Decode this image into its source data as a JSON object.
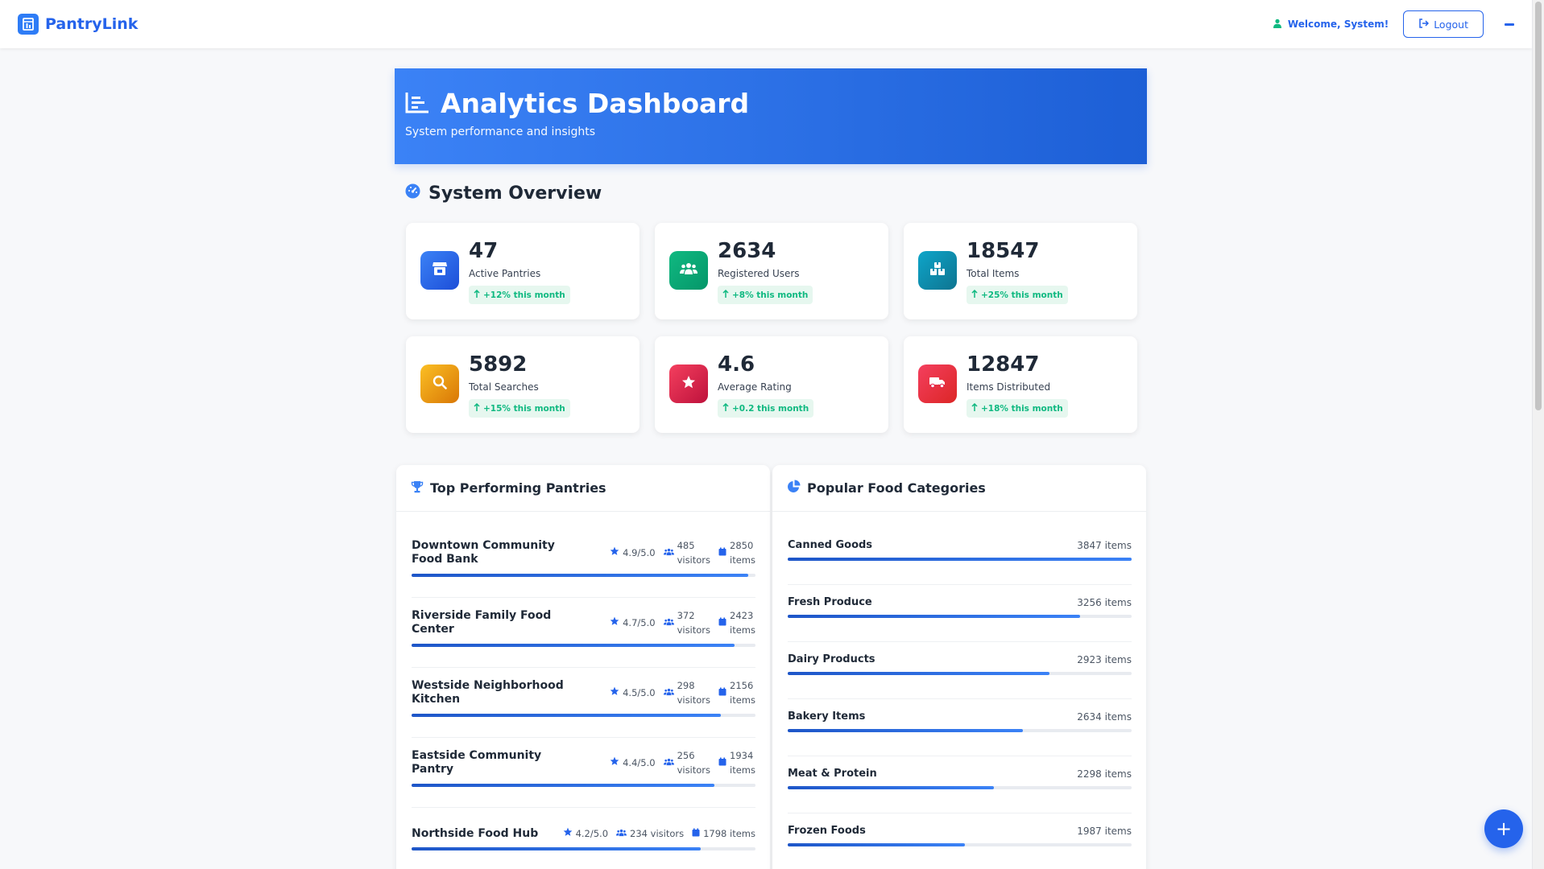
{
  "nav": {
    "brand": "PantryLink",
    "welcome": "Welcome, System!",
    "logout": "Logout"
  },
  "hero": {
    "title": "Analytics Dashboard",
    "subtitle": "System performance and insights"
  },
  "overview": {
    "title": "System Overview",
    "stats": [
      {
        "value": "47",
        "label": "Active Pantries",
        "change": "+12% this month",
        "icon": "store-icon",
        "color": "#2563eb"
      },
      {
        "value": "2634",
        "label": "Registered Users",
        "change": "+8% this month",
        "icon": "users-icon",
        "color": "#10b981"
      },
      {
        "value": "18547",
        "label": "Total Items",
        "change": "+25% this month",
        "icon": "boxes-icon",
        "color": "#0e8fb4"
      },
      {
        "value": "5892",
        "label": "Total Searches",
        "change": "+15% this month",
        "icon": "search-icon",
        "color": "#f59e0b"
      },
      {
        "value": "4.6",
        "label": "Average Rating",
        "change": "+0.2 this month",
        "icon": "star-icon",
        "color": "#e11d48"
      },
      {
        "value": "12847",
        "label": "Items Distributed",
        "change": "+18% this month",
        "icon": "truck-icon",
        "color": "#e11d48"
      }
    ]
  },
  "top_pantries": {
    "title": "Top Performing Pantries",
    "items": [
      {
        "name": "Downtown Community Food Bank",
        "rating": "4.9/5.0",
        "visitors": "485",
        "visitors_unit": "visitors",
        "items": "2850",
        "items_unit": "items",
        "progress": 0.98
      },
      {
        "name": "Riverside Family Food Center",
        "rating": "4.7/5.0",
        "visitors": "372",
        "visitors_unit": "visitors",
        "items": "2423",
        "items_unit": "items",
        "progress": 0.94
      },
      {
        "name": "Westside Neighborhood Kitchen",
        "rating": "4.5/5.0",
        "visitors": "298",
        "visitors_unit": "visitors",
        "items": "2156",
        "items_unit": "items",
        "progress": 0.9
      },
      {
        "name": "Eastside Community Pantry",
        "rating": "4.4/5.0",
        "visitors": "256",
        "visitors_unit": "visitors",
        "items": "1934",
        "items_unit": "items",
        "progress": 0.88
      },
      {
        "name": "Northside Food Hub",
        "rating": "4.2/5.0",
        "visitors": "234 visitors",
        "visitors_unit": "",
        "items": "1798 items",
        "items_unit": "",
        "progress": 0.84
      }
    ]
  },
  "categories": {
    "title": "Popular Food Categories",
    "items": [
      {
        "name": "Canned Goods",
        "count": "3847 items",
        "progress": 1.0
      },
      {
        "name": "Fresh Produce",
        "count": "3256 items",
        "progress": 0.85
      },
      {
        "name": "Dairy Products",
        "count": "2923 items",
        "progress": 0.76
      },
      {
        "name": "Bakery Items",
        "count": "2634 items",
        "progress": 0.685
      },
      {
        "name": "Meat & Protein",
        "count": "2298 items",
        "progress": 0.6
      },
      {
        "name": "Frozen Foods",
        "count": "1987 items",
        "progress": 0.515
      }
    ]
  },
  "fab_label": "+"
}
